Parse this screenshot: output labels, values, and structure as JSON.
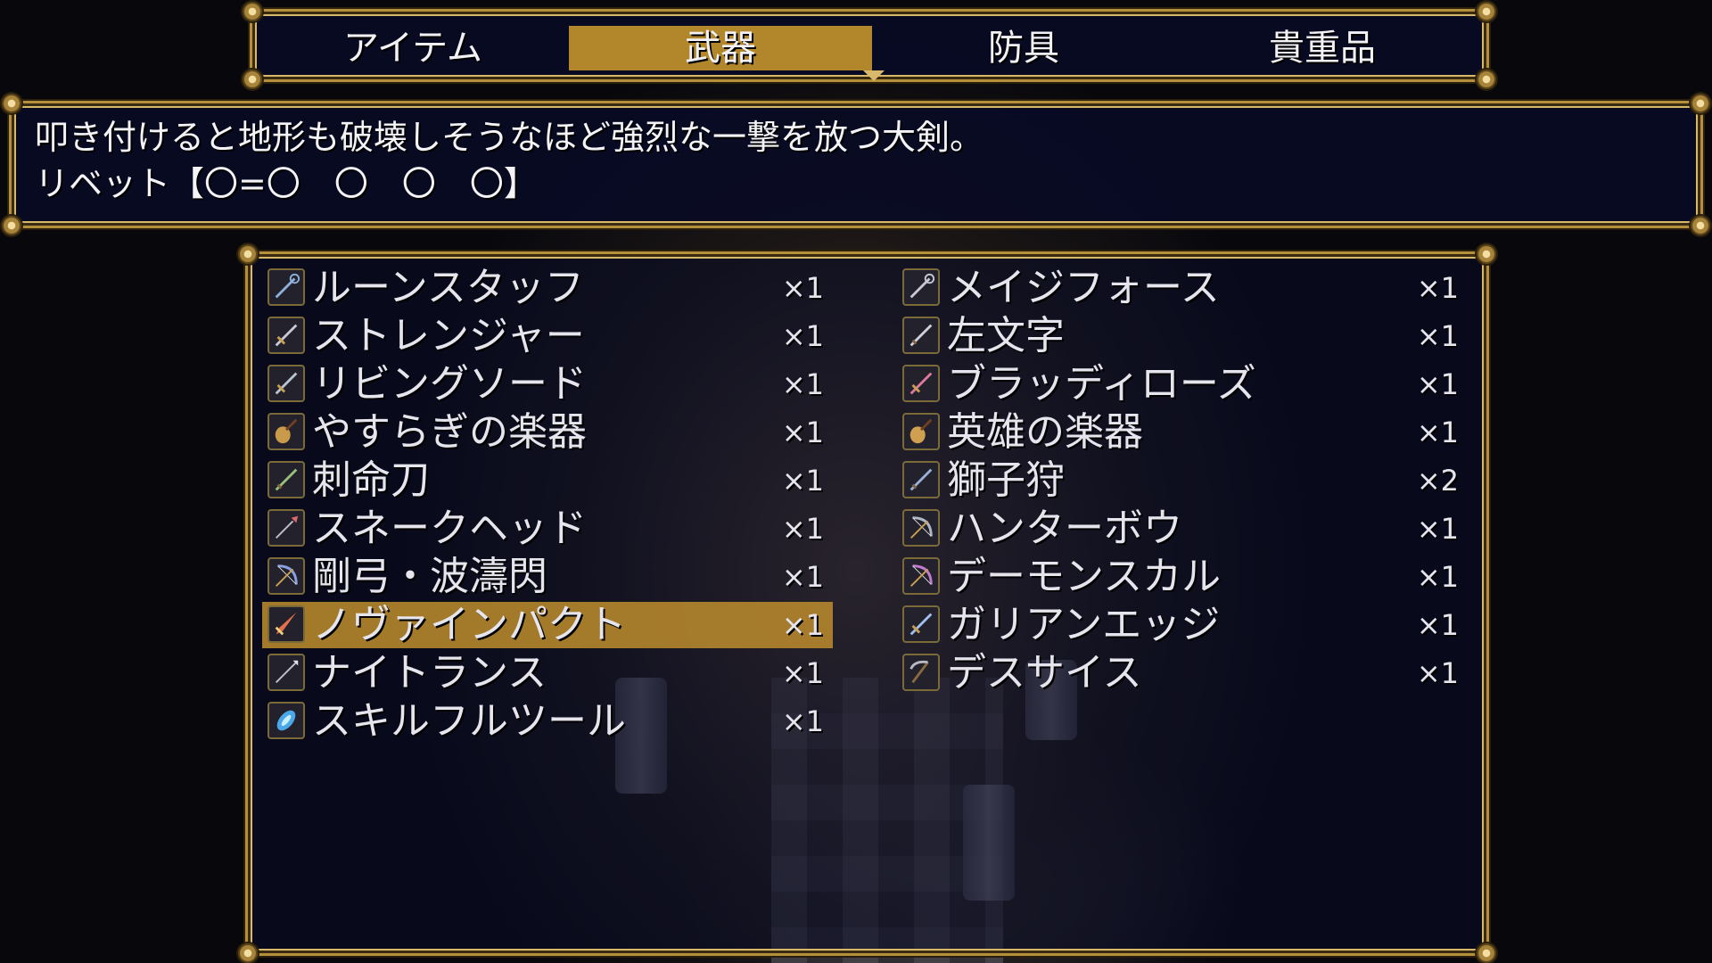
{
  "tabs": [
    {
      "label": "アイテム",
      "selected": false
    },
    {
      "label": "武器",
      "selected": true
    },
    {
      "label": "防具",
      "selected": false
    },
    {
      "label": "貴重品",
      "selected": false
    }
  ],
  "help": {
    "line1": "叩き付けると地形も破壊しそうなほど強烈な一撃を放つ大剣。",
    "line2": "リベット【〇=〇　〇　〇　〇】"
  },
  "items_left": [
    {
      "name": "ルーンスタッフ",
      "count": "×1",
      "icon": "staff-icon",
      "color": "#8fb0d8"
    },
    {
      "name": "ストレンジャー",
      "count": "×1",
      "icon": "sword-icon",
      "color": "#c9c9d6"
    },
    {
      "name": "リビングソード",
      "count": "×1",
      "icon": "sword-icon",
      "color": "#b8c4d0"
    },
    {
      "name": "やすらぎの楽器",
      "count": "×1",
      "icon": "lute-icon",
      "color": "#c89a4a"
    },
    {
      "name": "刺命刀",
      "count": "×1",
      "icon": "katana-icon",
      "color": "#9bbf7a"
    },
    {
      "name": "スネークヘッド",
      "count": "×1",
      "icon": "spear-icon",
      "color": "#d86a6a"
    },
    {
      "name": "剛弓・波濤閃",
      "count": "×1",
      "icon": "bow-icon",
      "color": "#8aa0e0"
    },
    {
      "name": "ノヴァインパクト",
      "count": "×1",
      "icon": "greatsword-icon",
      "color": "#e2704a"
    },
    {
      "name": "ナイトランス",
      "count": "×1",
      "icon": "lance-icon",
      "color": "#c0c0d0"
    },
    {
      "name": "スキルフルツール",
      "count": "×1",
      "icon": "tool-icon",
      "color": "#4aa8e8"
    }
  ],
  "items_right": [
    {
      "name": "メイジフォース",
      "count": "×1",
      "icon": "staff-icon",
      "color": "#c9c9d6"
    },
    {
      "name": "左文字",
      "count": "×1",
      "icon": "katana-icon",
      "color": "#d0d0dc"
    },
    {
      "name": "ブラッディローズ",
      "count": "×1",
      "icon": "sword-icon",
      "color": "#e07a9a"
    },
    {
      "name": "英雄の楽器",
      "count": "×1",
      "icon": "lute-icon",
      "color": "#d0a050"
    },
    {
      "name": "獅子狩",
      "count": "×2",
      "icon": "katana-icon",
      "color": "#9ab0d8"
    },
    {
      "name": "ハンターボウ",
      "count": "×1",
      "icon": "bow-icon",
      "color": "#b0b8c8"
    },
    {
      "name": "デーモンスカル",
      "count": "×1",
      "icon": "bow-icon",
      "color": "#c07ad0"
    },
    {
      "name": "ガリアンエッジ",
      "count": "×1",
      "icon": "sword-icon",
      "color": "#a0c0f0"
    },
    {
      "name": "デスサイス",
      "count": "×1",
      "icon": "scythe-icon",
      "color": "#b8b8c4"
    }
  ],
  "selected_item": "ノヴァインパクト",
  "colors": {
    "accent": "#b2862a",
    "frame": "#b4903c",
    "window": "#080a26"
  }
}
